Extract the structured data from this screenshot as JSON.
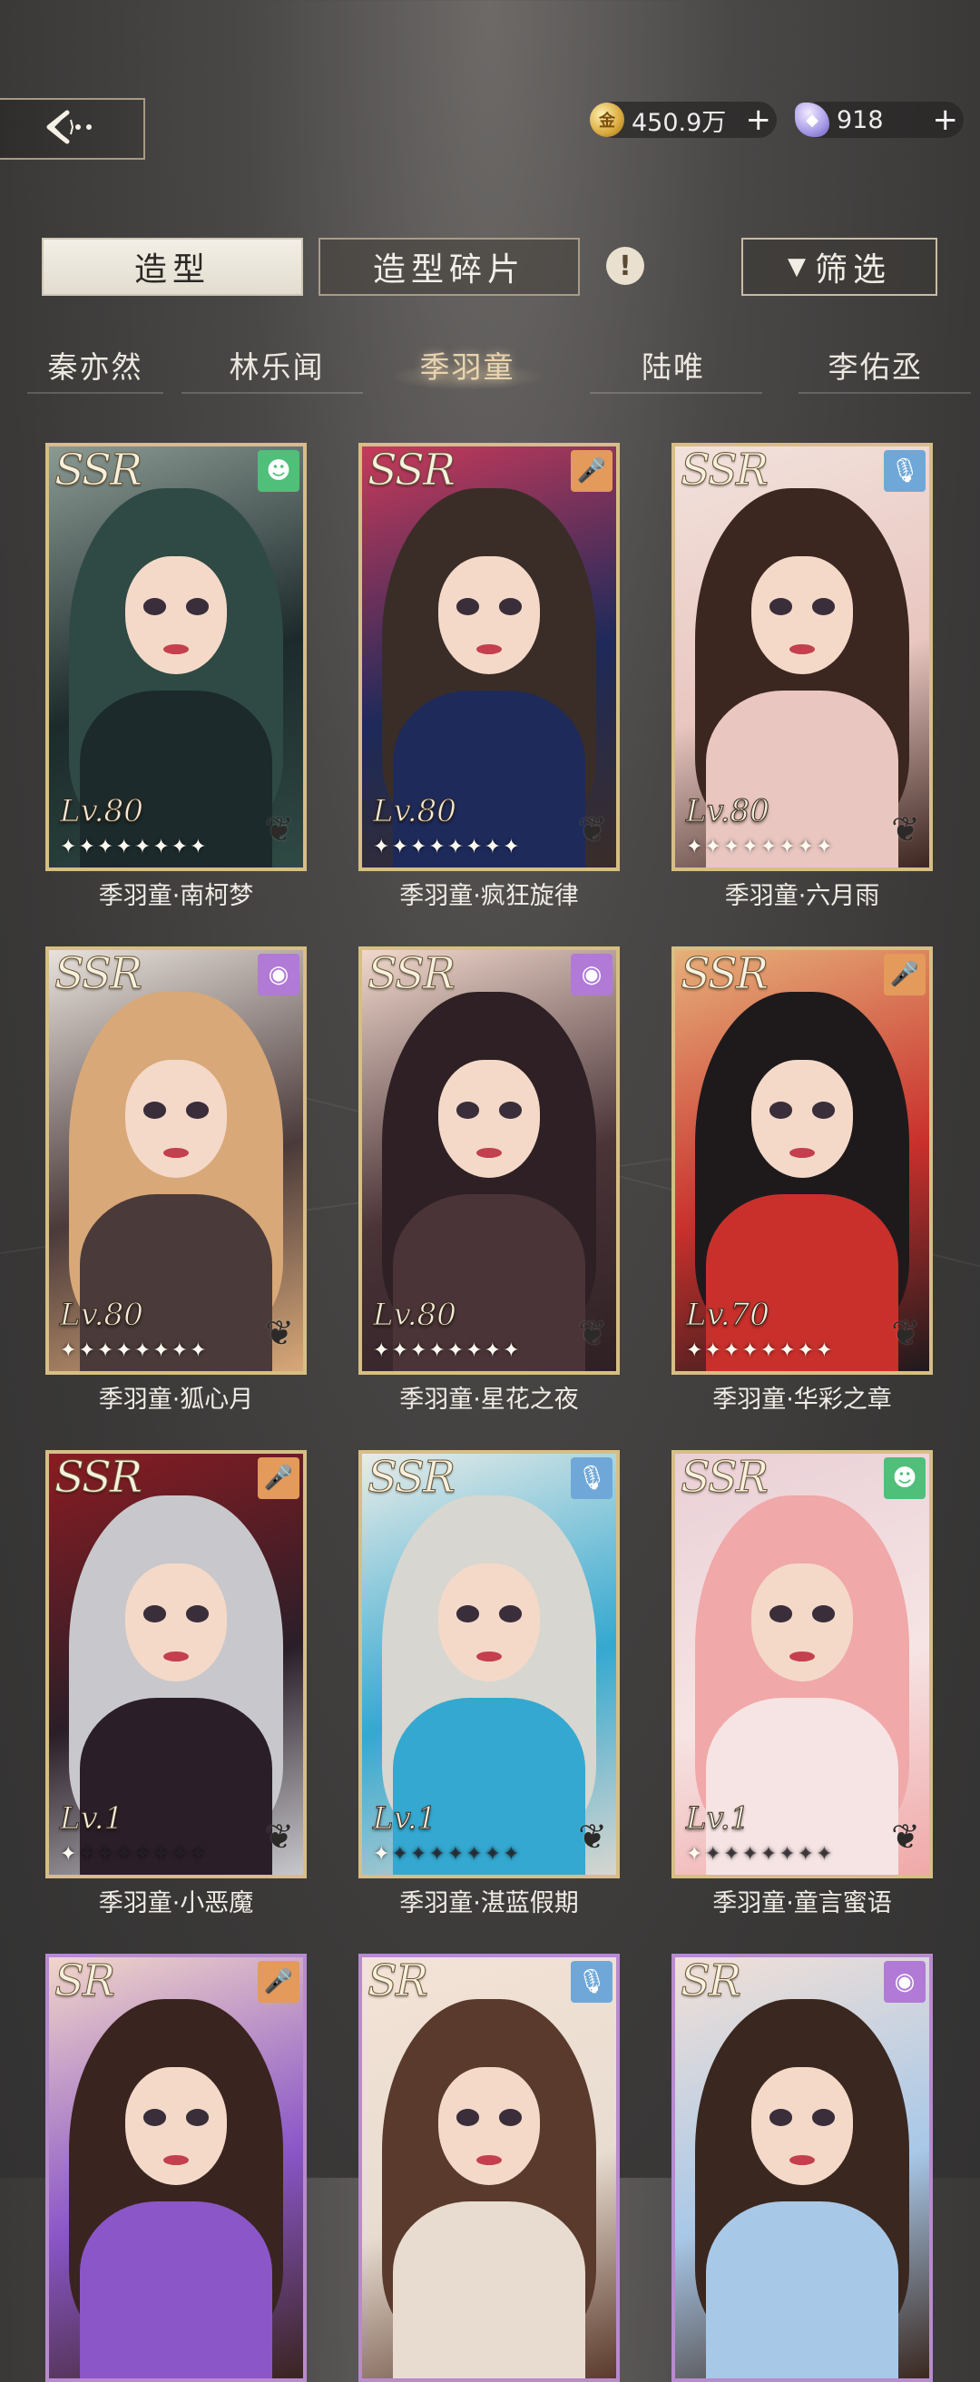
{
  "header": {
    "gold": {
      "icon": "gold-coin-icon",
      "value": "450.9万",
      "plus": "+"
    },
    "gem": {
      "icon": "diamond-icon",
      "value": "918",
      "plus": "+"
    }
  },
  "tabs": {
    "outfit": "造型",
    "fragments": "造型碎片",
    "alert": "!",
    "filter_icon": "▼",
    "filter": "筛选"
  },
  "characters": [
    "秦亦然",
    "林乐闻",
    "季羽童",
    "陆唯",
    "李佑丞"
  ],
  "selected_character": "季羽童",
  "cards": [
    {
      "rarity": "SSR",
      "level": "Lv.80",
      "stars": 8,
      "name": "季羽童·南柯梦",
      "badge": "smile",
      "badge_color": "#4fbf7a",
      "palette": [
        "#2f4a44",
        "#1c2a2b",
        "#8c9a94"
      ]
    },
    {
      "rarity": "SSR",
      "level": "Lv.80",
      "stars": 8,
      "name": "季羽童·疯狂旋律",
      "badge": "mic",
      "badge_color": "#e39a5a",
      "palette": [
        "#3a2d28",
        "#1e2a5a",
        "#c83a5a"
      ]
    },
    {
      "rarity": "SSR",
      "level": "Lv.80",
      "stars": 8,
      "name": "季羽童·六月雨",
      "badge": "mic2",
      "badge_color": "#6fa8d8",
      "palette": [
        "#3c2620",
        "#e9c6c0",
        "#f2e2dc"
      ]
    },
    {
      "rarity": "SSR",
      "level": "Lv.80",
      "stars": 8,
      "name": "季羽童·狐心月",
      "badge": "disc",
      "badge_color": "#b07ad6",
      "palette": [
        "#d8a878",
        "#4a3a3a",
        "#e8e2dc"
      ]
    },
    {
      "rarity": "SSR",
      "level": "Lv.80",
      "stars": 8,
      "name": "季羽童·星花之夜",
      "badge": "disc",
      "badge_color": "#b07ad6",
      "palette": [
        "#2e2024",
        "#4a3438",
        "#f0d8cc"
      ]
    },
    {
      "rarity": "SSR",
      "level": "Lv.70",
      "stars": 8,
      "name": "季羽童·华彩之章",
      "badge": "mic",
      "badge_color": "#e39a5a",
      "palette": [
        "#1e1a1c",
        "#c9302c",
        "#e6b07a"
      ]
    },
    {
      "rarity": "SSR",
      "level": "Lv.1",
      "stars": 1,
      "name": "季羽童·小恶魔",
      "badge": "mic",
      "badge_color": "#e39a5a",
      "palette": [
        "#c8c8cc",
        "#2a1e28",
        "#8a1c22"
      ]
    },
    {
      "rarity": "SSR",
      "level": "Lv.1",
      "stars": 1,
      "name": "季羽童·湛蓝假期",
      "badge": "mic2",
      "badge_color": "#6fa8d8",
      "palette": [
        "#d8d6d0",
        "#34a8d0",
        "#e8ece8"
      ]
    },
    {
      "rarity": "SSR",
      "level": "Lv.1",
      "stars": 1,
      "name": "季羽童·童言蜜语",
      "badge": "smile",
      "badge_color": "#4fbf7a",
      "palette": [
        "#f0a8a8",
        "#f6e4e4",
        "#e9d0d6"
      ]
    },
    {
      "rarity": "SR",
      "level": "",
      "stars": 0,
      "name": "",
      "badge": "mic",
      "badge_color": "#e39a5a",
      "palette": [
        "#3a2420",
        "#8a56c8",
        "#f2d6c8"
      ]
    },
    {
      "rarity": "SR",
      "level": "",
      "stars": 0,
      "name": "",
      "badge": "mic2",
      "badge_color": "#6fa8d8",
      "palette": [
        "#5a3a2c",
        "#e8dcd0",
        "#f4e2d6"
      ]
    },
    {
      "rarity": "SR",
      "level": "",
      "stars": 0,
      "name": "",
      "badge": "disc",
      "badge_color": "#b07ad6",
      "palette": [
        "#3a2820",
        "#a8c8e8",
        "#f2e0d6"
      ]
    }
  ],
  "icons": {
    "back": "back-arrow-icon",
    "smile": "☻",
    "mic": "🎤",
    "mic2": "🎙",
    "disc": "◉"
  }
}
